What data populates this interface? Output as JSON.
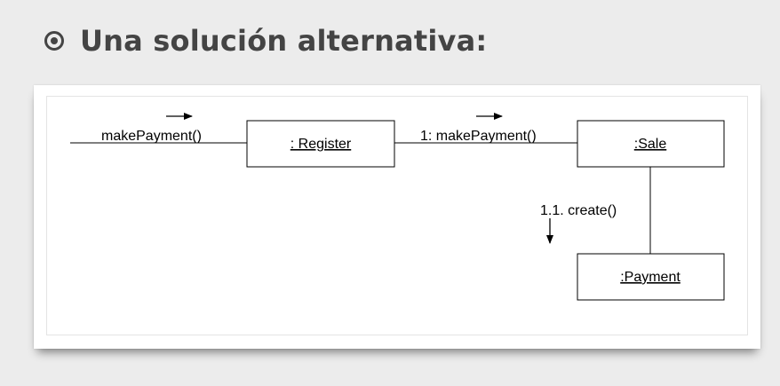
{
  "slide": {
    "title": "Una solución alternativa:"
  },
  "diagram": {
    "objects": {
      "register": ": Register",
      "sale": ":Sale",
      "payment": ":Payment"
    },
    "messages": {
      "incoming": "makePayment()",
      "register_to_sale": "1: makePayment()",
      "sale_creates_payment": "1.1. create()"
    }
  }
}
